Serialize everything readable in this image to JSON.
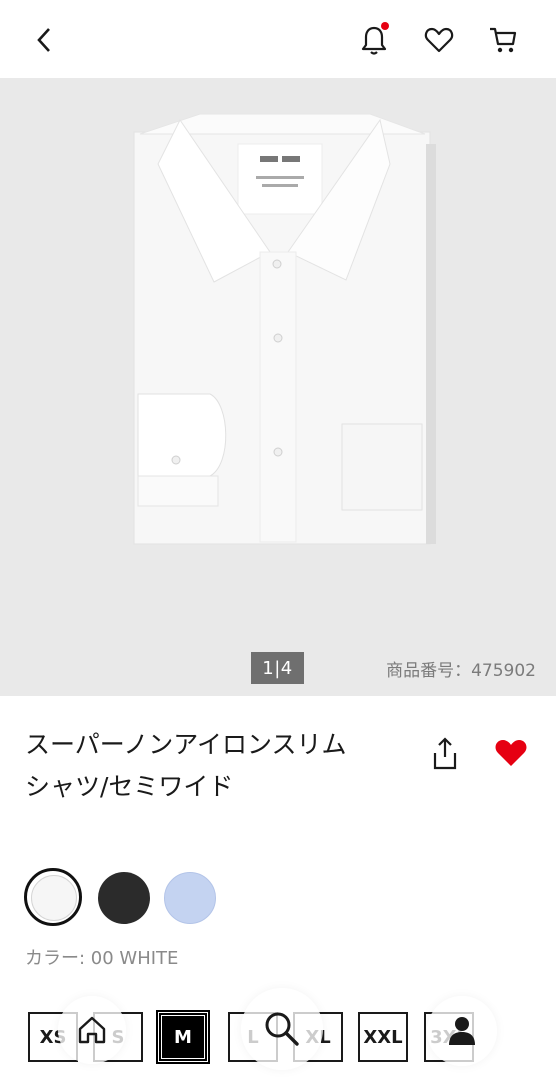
{
  "header": {
    "icons": [
      "back-icon",
      "bell-icon",
      "heart-icon",
      "cart-icon"
    ],
    "notification_dot_color": "#e60012"
  },
  "gallery": {
    "page_current": "1",
    "page_total": "4",
    "product_code_label": "商品番号：475902"
  },
  "product": {
    "title_line1": "スーパーノンアイロンスリム",
    "title_line2": "シャツ/セミワイド",
    "favorite_color": "#e60012"
  },
  "colors": {
    "label": "カラー: 00 WHITE",
    "swatches": [
      {
        "name": "white",
        "hex": "#f6f6f6",
        "selected": true
      },
      {
        "name": "black",
        "hex": "#2b2b2b",
        "selected": false
      },
      {
        "name": "blue",
        "hex": "#c4d3f1",
        "selected": false
      }
    ]
  },
  "sizes": {
    "options": [
      "XS",
      "S",
      "M",
      "L",
      "XL",
      "XXL",
      "3XL"
    ],
    "selected": "M"
  },
  "bottom_nav": {
    "items": [
      "home-icon",
      "search-icon",
      "account-icon"
    ]
  }
}
